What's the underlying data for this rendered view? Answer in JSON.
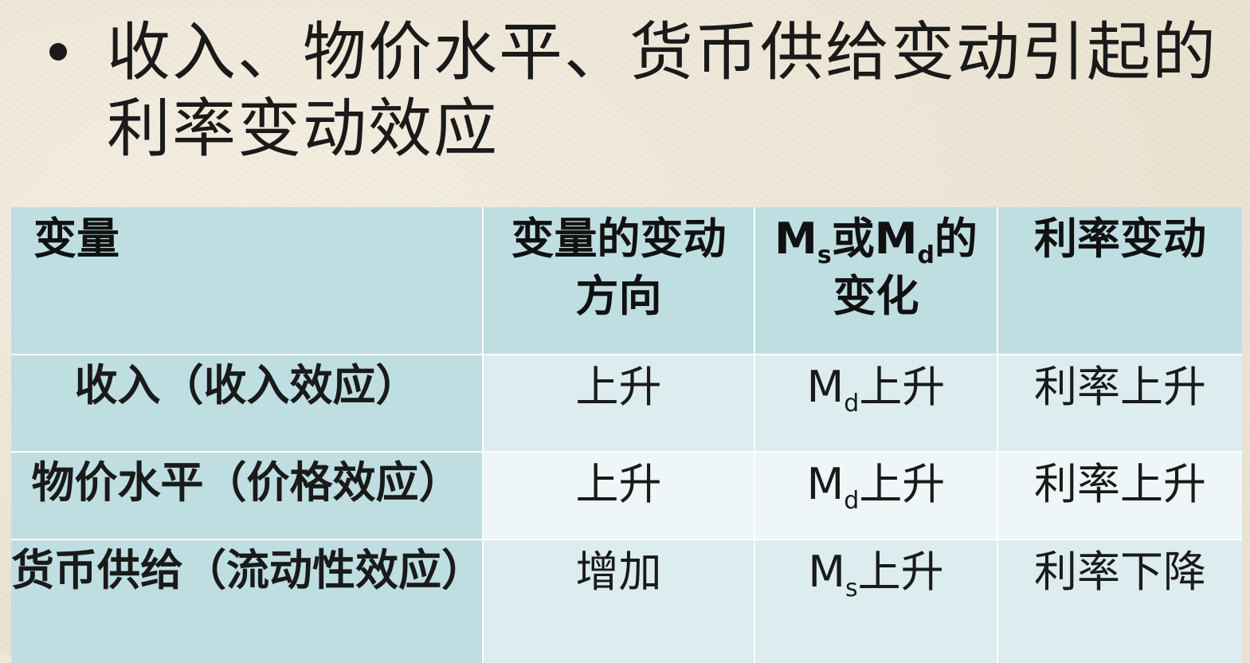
{
  "title": {
    "line1": "收入、物价水平、货币供给变动引起的",
    "line2": "利率变动效应"
  },
  "table": {
    "headers": {
      "variable": "变量",
      "direction_line1": "变量的变动",
      "direction_line2": "方向",
      "m_base": "M",
      "m_s_sub": "s",
      "or": "或",
      "m_d_sub": "d",
      "de": "的",
      "change_line2": "变化",
      "rate_change": "利率变动"
    },
    "rows": [
      {
        "variable": "收入（收入效应）",
        "direction": "上升",
        "m_base": "M",
        "m_sub": "d",
        "m_change": "上升",
        "rate": "利率上升"
      },
      {
        "variable": "物价水平（价格效应）",
        "direction": "上升",
        "m_base": "M",
        "m_sub": "d",
        "m_change": "上升",
        "rate": "利率上升"
      },
      {
        "variable": "货币供给（流动性效应）",
        "direction": "增加",
        "m_base": "M",
        "m_sub": "s",
        "m_change": "上升",
        "rate": "利率下降"
      }
    ]
  }
}
